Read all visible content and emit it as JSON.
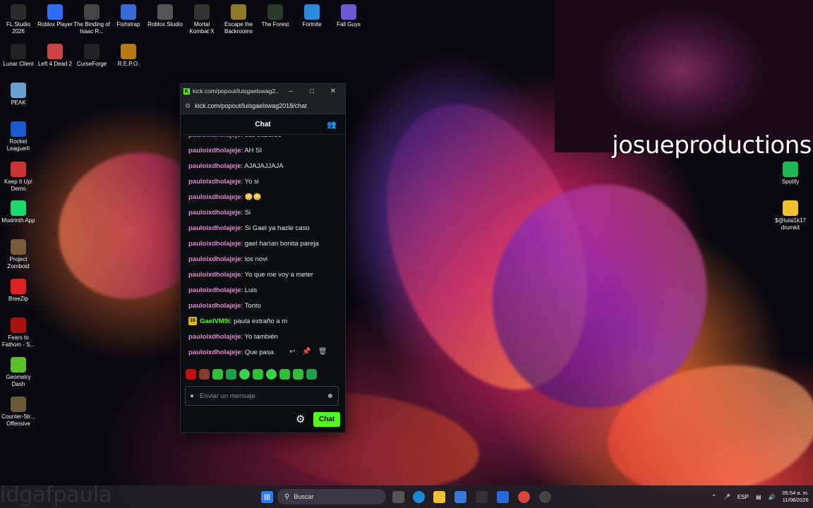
{
  "desktop_icons": [
    {
      "label": "FL Studio 2026",
      "icon": "fl-studio-icon",
      "color": "#2b2b2b"
    },
    {
      "label": "Roblox Player",
      "icon": "roblox-icon",
      "color": "#2f6bff"
    },
    {
      "label": "The Binding of Isaac R...",
      "icon": "isaac-icon",
      "color": "#444"
    },
    {
      "label": "Fishstrap",
      "icon": "fishstrap-icon",
      "color": "#3a6ad6"
    },
    {
      "label": "Roblox Studio",
      "icon": "roblox-studio-icon",
      "color": "#555"
    },
    {
      "label": "Mortal Kombat X",
      "icon": "mortal-kombat-icon",
      "color": "#333"
    },
    {
      "label": "Escape the Backrooms",
      "icon": "backrooms-icon",
      "color": "#8a7a2a"
    },
    {
      "label": "The Forest",
      "icon": "the-forest-icon",
      "color": "#2a3a2a"
    },
    {
      "label": "Fortnite",
      "icon": "fortnite-icon",
      "color": "#2a8ce0"
    },
    {
      "label": "Fall Guys",
      "icon": "fall-guys-icon",
      "color": "#6a5ad6"
    },
    {
      "label": "Lunar Client",
      "icon": "lunar-client-icon",
      "color": "#222"
    },
    {
      "label": "Left 4 Dead 2",
      "icon": "left4dead-icon",
      "color": "#c44"
    },
    {
      "label": "CurseForge",
      "icon": "curseforge-icon",
      "color": "#222"
    },
    {
      "label": "R.E.P.O.",
      "icon": "repo-icon",
      "color": "#b87a10"
    },
    {
      "label": "PEAK",
      "icon": "peak-icon",
      "color": "#6aa0d0"
    },
    {
      "label": "Rocket League®",
      "icon": "rocket-league-icon",
      "color": "#1a5ad0"
    },
    {
      "label": "Keep It Up! Demo",
      "icon": "keep-it-up-icon",
      "color": "#c33"
    },
    {
      "label": "Modrinth App",
      "icon": "modrinth-icon",
      "color": "#1bd96a"
    },
    {
      "label": "Project Zomboid",
      "icon": "zomboid-icon",
      "color": "#7a5a3a"
    },
    {
      "label": "BreeZip",
      "icon": "breezip-icon",
      "color": "#d22"
    },
    {
      "label": "Fears to Fathom - S...",
      "icon": "fears-to-fathom-icon",
      "color": "#a11"
    },
    {
      "label": "Geometry Dash",
      "icon": "geometry-dash-icon",
      "color": "#5ac02a"
    },
    {
      "label": "Counter-Str... Offensive",
      "icon": "counter-strike-icon",
      "color": "#6a5a3a"
    },
    {
      "label": "Spotify",
      "icon": "spotify-icon",
      "color": "#1db954"
    },
    {
      "label": "$@luisi1k17 drumkit",
      "icon": "folder-icon",
      "color": "#f0c030"
    }
  ],
  "webcam": {
    "caption": "josueproductions"
  },
  "overlay_text": "idgafpaula",
  "popout": {
    "title": "kick.com/popout/luisgaelswag2...",
    "url": "kick.com/popout/luisgaelswag2018/chat",
    "chat_title": "Chat",
    "messages": [
      {
        "user": "pauloixdholajeje",
        "text": "sus traseros"
      },
      {
        "user": "pauloixdholajeje",
        "text": "AH SI"
      },
      {
        "user": "pauloixdholajeje",
        "text": "AJAJAJJAJA"
      },
      {
        "user": "pauloixdholajeje",
        "text": "Yo si"
      },
      {
        "user": "pauloixdholajeje",
        "text": "😳😳"
      },
      {
        "user": "pauloixdholajeje",
        "text": "Si"
      },
      {
        "user": "pauloixdholajeje",
        "text": "Si Gael ya hazle caso"
      },
      {
        "user": "pauloixdholajeje",
        "text": "gael harían bonita pareja"
      },
      {
        "user": "pauloixdholajeje",
        "text": "los novi"
      },
      {
        "user": "pauloixdholajeje",
        "text": "Yo que me voy a meter"
      },
      {
        "user": "pauloixdholajeje",
        "text": "Luis"
      },
      {
        "user": "pauloixdholajeje",
        "text": "Tonto"
      },
      {
        "user": "GaelVM9i",
        "text": "paula extraño a m",
        "badge": "16"
      },
      {
        "user": "pauloixdholajeje",
        "text": "Yo también"
      },
      {
        "user": "pauloixdholajeje",
        "text": "Que pasa"
      }
    ],
    "input_placeholder": "Enviar un mensaje",
    "send_label": "Chat"
  },
  "taskbar": {
    "search_label": "Buscar",
    "language": "ESP",
    "time": "05:54 a. m.",
    "date": "11/08/2026"
  }
}
